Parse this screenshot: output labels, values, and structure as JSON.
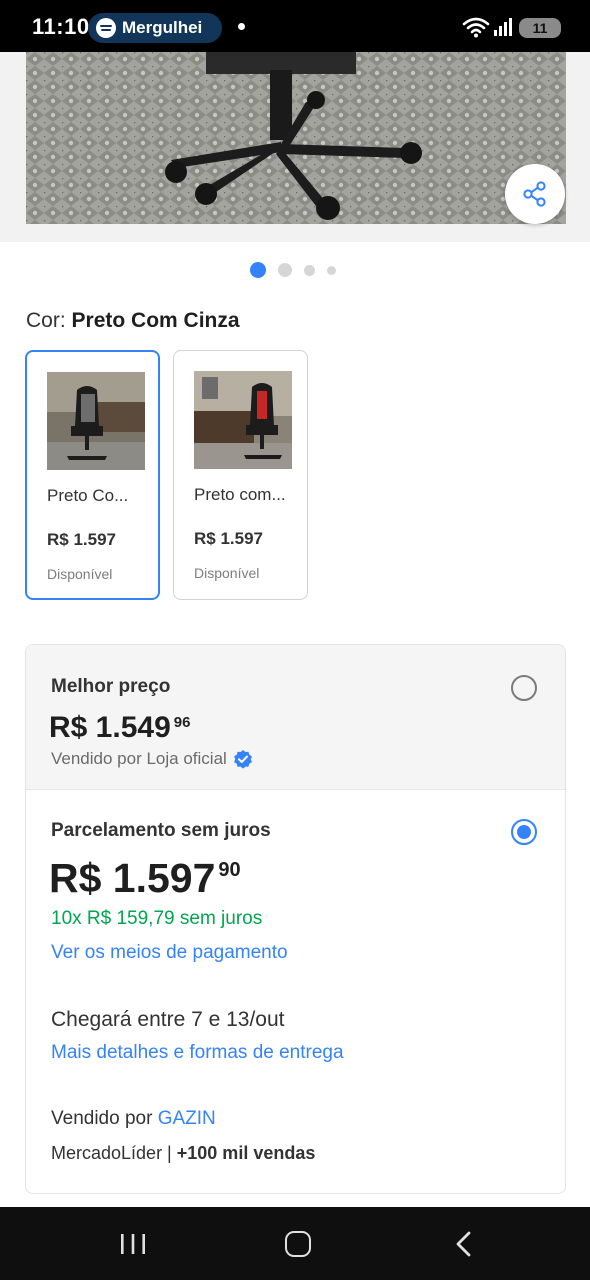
{
  "status_bar": {
    "time": "11:10",
    "media_app": "Mergulhei",
    "battery": "11"
  },
  "product": {
    "image_count": 4,
    "active_image": 1,
    "share_icon": "share-icon"
  },
  "color_selector": {
    "label": "Cor:",
    "selected_value": "Preto Com Cinza",
    "variants": [
      {
        "name": "Preto Co...",
        "price": "R$ 1.597",
        "status": "Disponível",
        "selected": true
      },
      {
        "name": "Preto com...",
        "price": "R$ 1.597",
        "status": "Disponível",
        "selected": false
      }
    ]
  },
  "offers": {
    "best_price": {
      "title": "Melhor preço",
      "price_main": "R$ 1.549",
      "price_cents": "96",
      "sold_by": "Vendido por Loja oficial",
      "selected": false
    },
    "installments": {
      "title": "Parcelamento sem juros",
      "price_main": "R$ 1.597",
      "price_cents": "90",
      "installment_text": "10x R$ 159,79 sem juros",
      "payment_link": "Ver os meios de pagamento",
      "selected": true
    },
    "delivery_text": "Chegará entre 7 e 13/out",
    "delivery_link": "Mais detalhes e formas de entrega",
    "seller_prefix": "Vendido por",
    "seller_name": "GAZIN",
    "seller_badge": "MercadoLíder |",
    "seller_sales": "+100 mil vendas"
  },
  "colors": {
    "accent": "#3483fa",
    "green": "#00a650",
    "status_bar": "#000000"
  }
}
